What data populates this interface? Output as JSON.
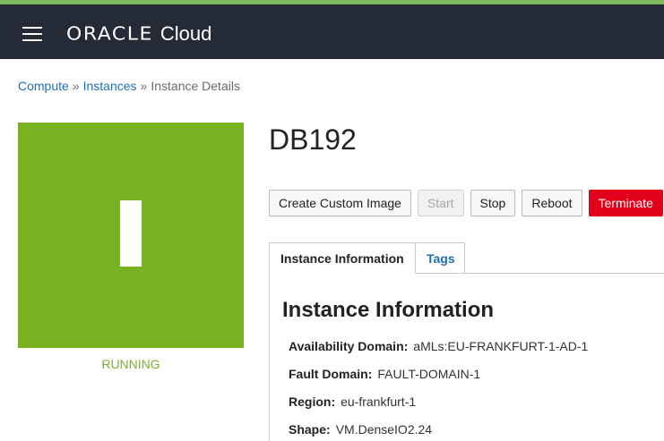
{
  "header": {
    "brand_oracle": "ORACLE",
    "brand_cloud": "Cloud"
  },
  "breadcrumb": {
    "items": [
      "Compute",
      "Instances",
      "Instance Details"
    ],
    "separator": "»"
  },
  "instance": {
    "name": "DB192",
    "state": "RUNNING",
    "state_color": "#78b222"
  },
  "actions": {
    "create_custom_image": "Create Custom Image",
    "start": "Start",
    "stop": "Stop",
    "reboot": "Reboot",
    "terminate": "Terminate"
  },
  "tabs": {
    "info": "Instance Information",
    "tags": "Tags"
  },
  "info": {
    "title": "Instance Information",
    "fields": [
      {
        "label": "Availability Domain:",
        "value": "aMLs:EU-FRANKFURT-1-AD-1"
      },
      {
        "label": "Fault Domain:",
        "value": "FAULT-DOMAIN-1"
      },
      {
        "label": "Region:",
        "value": "eu-frankfurt-1"
      },
      {
        "label": "Shape:",
        "value": "VM.DenseIO2.24"
      }
    ]
  },
  "colors": {
    "navbar": "#242b36",
    "accent_strip": "#7dbb5a",
    "link": "#1e6fb8",
    "danger": "#e2001a"
  }
}
